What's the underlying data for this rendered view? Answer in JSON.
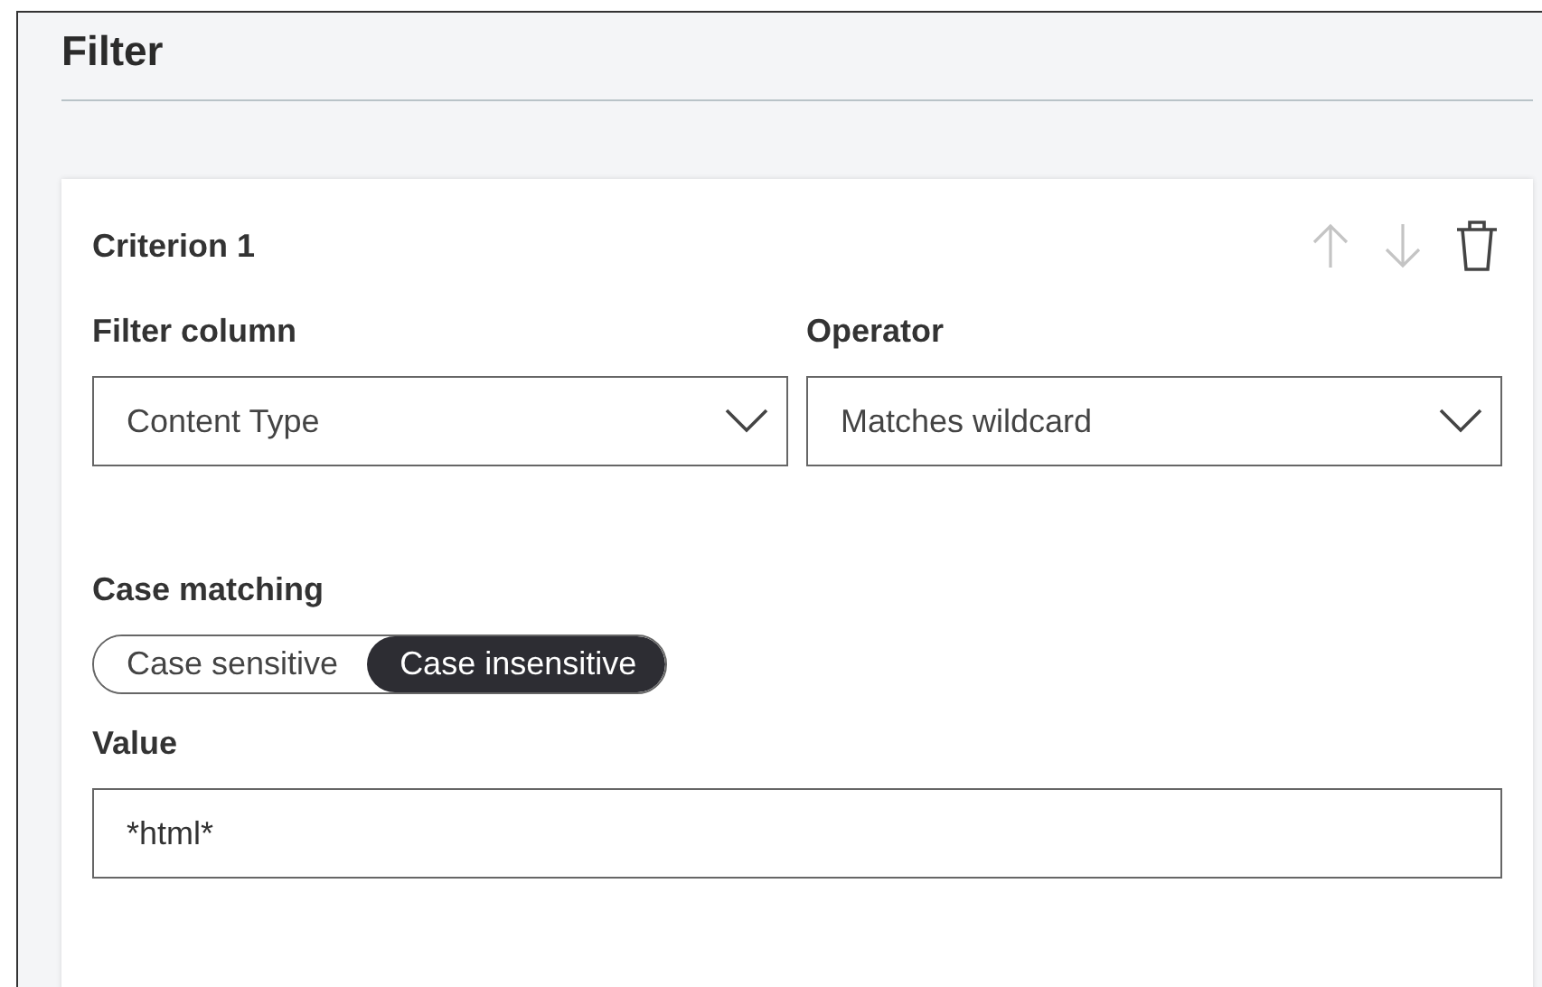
{
  "title": "Filter",
  "criterion": {
    "title": "Criterion 1",
    "actions": [
      {
        "kind": "up",
        "disabled": true
      },
      {
        "kind": "down",
        "disabled": true
      },
      {
        "kind": "delete",
        "disabled": false
      }
    ],
    "filter_column": {
      "label": "Filter column",
      "value": "Content Type"
    },
    "operator": {
      "label": "Operator",
      "value": "Matches wildcard"
    },
    "case_matching": {
      "label": "Case matching",
      "options": [
        {
          "label": "Case sensitive",
          "selected": false
        },
        {
          "label": "Case insensitive",
          "selected": true
        }
      ]
    },
    "value": {
      "label": "Value",
      "value": "*html*"
    }
  }
}
